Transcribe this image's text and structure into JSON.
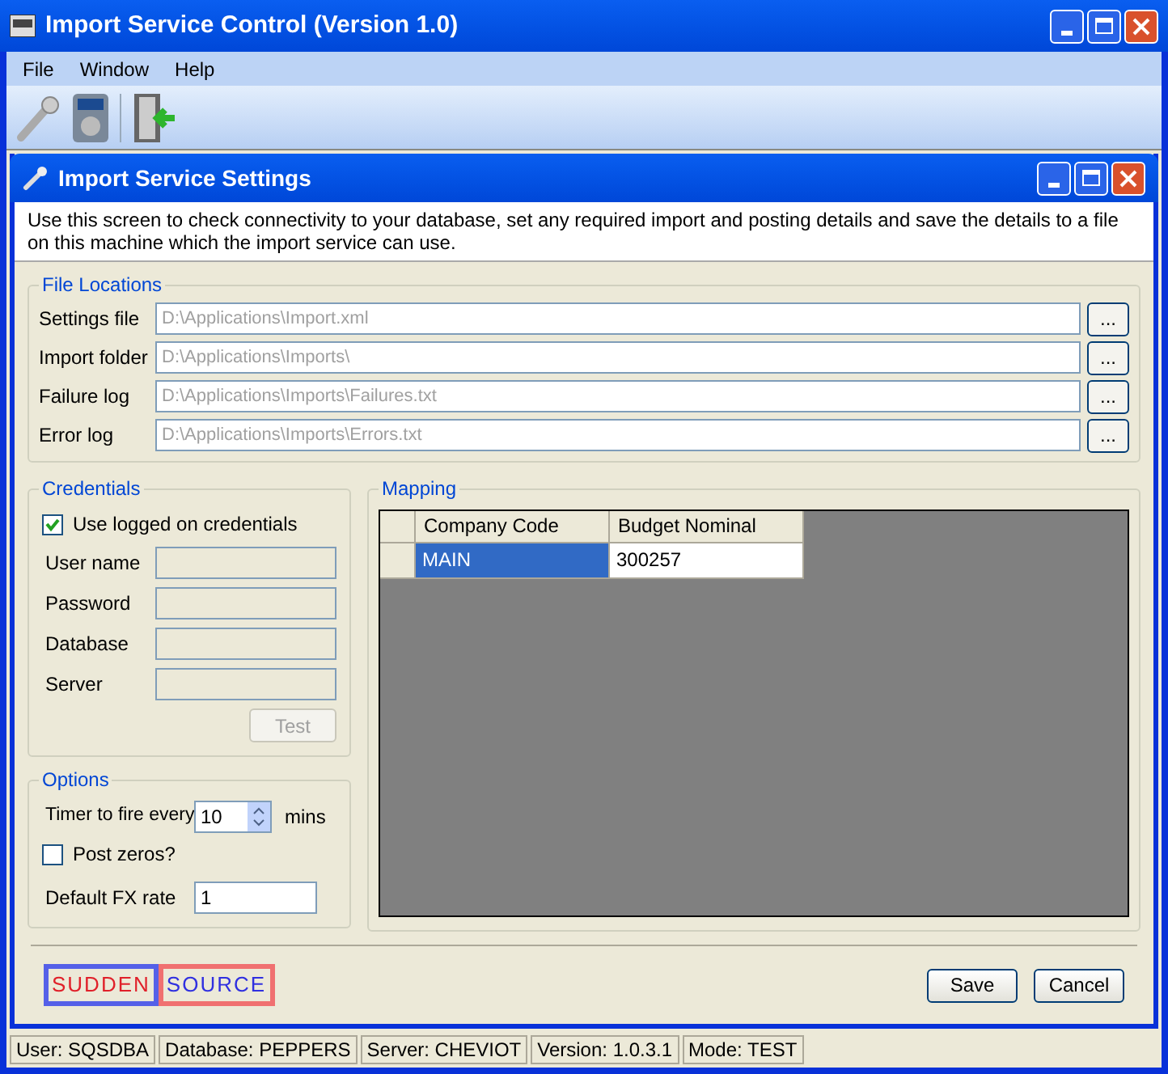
{
  "window": {
    "title": "Import Service Control (Version 1.0)"
  },
  "menu": [
    "File",
    "Window",
    "Help"
  ],
  "child_window": {
    "title": "Import Service Settings",
    "description": "Use this screen to check connectivity to your database, set any required import and posting details and save the details to a file on this machine which the import service can use."
  },
  "file_locations": {
    "title": "File Locations",
    "fields": [
      {
        "label": "Settings file",
        "value": "D:\\Applications\\Import.xml",
        "disabled": true,
        "browse": "..."
      },
      {
        "label": "Import folder",
        "value": "D:\\Applications\\Imports\\",
        "disabled": true,
        "browse": "..."
      },
      {
        "label": "Failure log",
        "value": "D:\\Applications\\Imports\\Failures.txt",
        "disabled": true,
        "browse": "..."
      },
      {
        "label": "Error log",
        "value": "D:\\Applications\\Imports\\Errors.txt",
        "disabled": true,
        "browse": "..."
      }
    ]
  },
  "credentials": {
    "title": "Credentials",
    "use_logged_on": {
      "label": "Use logged on credentials",
      "checked": true
    },
    "fields": [
      "User name",
      "Password",
      "Database",
      "Server"
    ],
    "test_button": {
      "label": "Test",
      "disabled": true
    }
  },
  "options": {
    "title": "Options",
    "timer": {
      "label": "Timer to fire every",
      "value": "10",
      "unit": "mins"
    },
    "post_zeros": {
      "label": "Post zeros?",
      "checked": false
    },
    "fx_rate": {
      "label": "Default FX rate",
      "value": "1"
    }
  },
  "mapping": {
    "title": "Mapping",
    "columns": [
      "Company Code",
      "Budget Nominal"
    ],
    "rows": [
      {
        "cells": [
          {
            "text": "MAIN",
            "selected": true
          },
          {
            "text": "300257",
            "selected": false
          }
        ]
      }
    ]
  },
  "logo": {
    "left": "SUDDEN",
    "right": "SOURCE"
  },
  "buttons": [
    "Save",
    "Cancel"
  ],
  "status_bar": [
    "User: SQSDBA",
    "Database: PEPPERS",
    "Server: CHEVIOT",
    "Version: 1.0.3.1",
    "Mode: TEST"
  ]
}
